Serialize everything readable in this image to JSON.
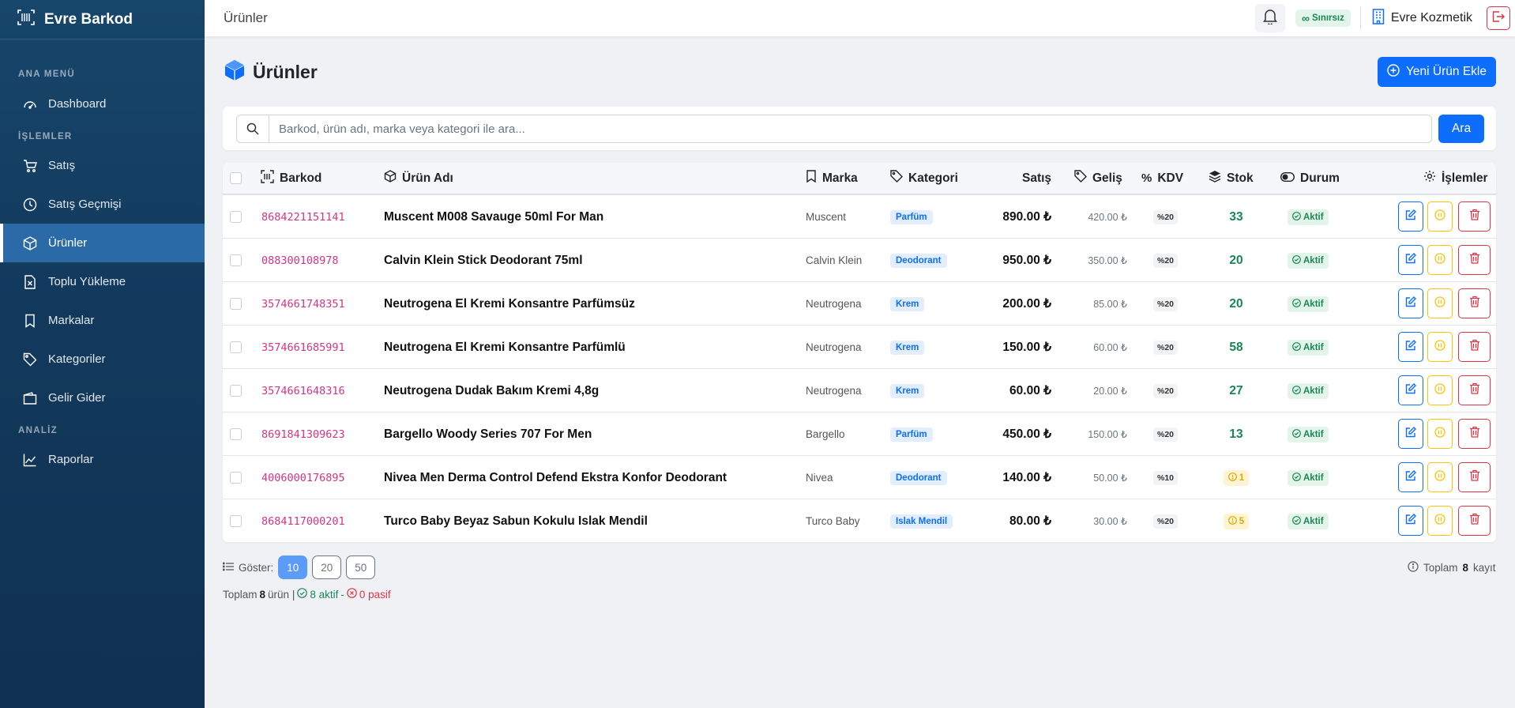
{
  "app": {
    "name": "Evre Barkod"
  },
  "sidebar": {
    "sections": [
      {
        "title": "ANA MENÜ",
        "items": [
          {
            "label": "Dashboard",
            "icon": "speedometer-icon"
          }
        ]
      },
      {
        "title": "İŞLEMLER",
        "items": [
          {
            "label": "Satış",
            "icon": "cart-icon"
          },
          {
            "label": "Satış Geçmişi",
            "icon": "clock-icon"
          },
          {
            "label": "Ürünler",
            "icon": "box-icon",
            "active": true
          },
          {
            "label": "Toplu Yükleme",
            "icon": "excel-file-icon"
          },
          {
            "label": "Markalar",
            "icon": "bookmark-icon"
          },
          {
            "label": "Kategoriler",
            "icon": "tags-icon"
          },
          {
            "label": "Gelir Gider",
            "icon": "wallet-icon"
          }
        ]
      },
      {
        "title": "ANALİZ",
        "items": [
          {
            "label": "Raporlar",
            "icon": "graph-up-icon"
          }
        ]
      }
    ]
  },
  "topbar": {
    "title": "Ürünler",
    "plan_badge": "Sınırsız",
    "company": "Evre Kozmetik"
  },
  "page": {
    "title": "Ürünler",
    "add_button": "Yeni Ürün Ekle"
  },
  "search": {
    "placeholder": "Barkod, ürün adı, marka veya kategori ile ara...",
    "value": "",
    "button": "Ara"
  },
  "table": {
    "columns": {
      "barcode": "Barkod",
      "name": "Ürün Adı",
      "brand": "Marka",
      "category": "Kategori",
      "sale": "Satış",
      "cost": "Geliş",
      "vat": "KDV",
      "stock": "Stok",
      "status": "Durum",
      "actions": "İşlemler"
    },
    "rows": [
      {
        "barcode": "8684221151141",
        "name": "Muscent M008 Savauge 50ml For Man",
        "brand": "Muscent",
        "category": "Parfüm",
        "sale": "890.00 ₺",
        "cost": "420.00 ₺",
        "vat": "%20",
        "stock": "33",
        "low_stock": false,
        "status": "Aktif"
      },
      {
        "barcode": "088300108978",
        "name": "Calvin Klein Stick Deodorant 75ml",
        "brand": "Calvin Klein",
        "category": "Deodorant",
        "sale": "950.00 ₺",
        "cost": "350.00 ₺",
        "vat": "%20",
        "stock": "20",
        "low_stock": false,
        "status": "Aktif"
      },
      {
        "barcode": "3574661748351",
        "name": "Neutrogena El Kremi Konsantre Parfümsüz",
        "brand": "Neutrogena",
        "category": "Krem",
        "sale": "200.00 ₺",
        "cost": "85.00 ₺",
        "vat": "%20",
        "stock": "20",
        "low_stock": false,
        "status": "Aktif"
      },
      {
        "barcode": "3574661685991",
        "name": "Neutrogena El Kremi Konsantre Parfümlü",
        "brand": "Neutrogena",
        "category": "Krem",
        "sale": "150.00 ₺",
        "cost": "60.00 ₺",
        "vat": "%20",
        "stock": "58",
        "low_stock": false,
        "status": "Aktif"
      },
      {
        "barcode": "3574661648316",
        "name": "Neutrogena Dudak Bakım Kremi 4,8g",
        "brand": "Neutrogena",
        "category": "Krem",
        "sale": "60.00 ₺",
        "cost": "20.00 ₺",
        "vat": "%20",
        "stock": "27",
        "low_stock": false,
        "status": "Aktif"
      },
      {
        "barcode": "8691841309623",
        "name": "Bargello Woody Series 707 For Men",
        "brand": "Bargello",
        "category": "Parfüm",
        "sale": "450.00 ₺",
        "cost": "150.00 ₺",
        "vat": "%20",
        "stock": "13",
        "low_stock": false,
        "status": "Aktif"
      },
      {
        "barcode": "4006000176895",
        "name": "Nivea Men Derma Control Defend Ekstra Konfor Deodorant",
        "brand": "Nivea",
        "category": "Deodorant",
        "sale": "140.00 ₺",
        "cost": "50.00 ₺",
        "vat": "%10",
        "stock": "1",
        "low_stock": true,
        "status": "Aktif"
      },
      {
        "barcode": "8684117000201",
        "name": "Turco Baby Beyaz Sabun Kokulu Islak Mendil",
        "brand": "Turco Baby",
        "category": "Islak Mendil",
        "sale": "80.00 ₺",
        "cost": "30.00 ₺",
        "vat": "%20",
        "stock": "5",
        "low_stock": true,
        "status": "Aktif"
      }
    ]
  },
  "footer": {
    "show_label": "Göster:",
    "page_sizes": [
      "10",
      "20",
      "50"
    ],
    "selected_page_size": "10",
    "total_label_prefix": "Toplam",
    "total_count": "8",
    "total_label_suffix": "kayıt",
    "summary_prefix": "Toplam",
    "summary_count": "8",
    "summary_unit": "ürün |",
    "active_text": "8 aktif",
    "separator": "-",
    "passive_text": "0 pasif"
  },
  "colors": {
    "primary": "#0d6efd",
    "sidebar": "#12395c",
    "success": "#198754",
    "warning": "#ffc107",
    "danger": "#dc3545",
    "barcode": "#d63384"
  }
}
